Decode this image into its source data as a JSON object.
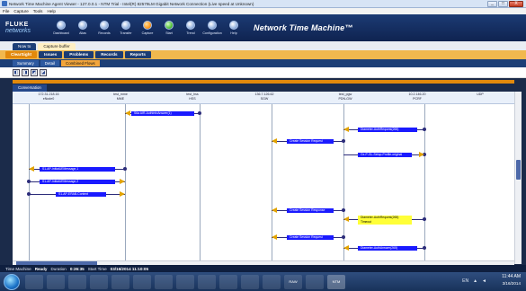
{
  "window": {
    "title": "Network Time Machine Agent Viewer - 127.0.0.1 - NTM Trial - Intel(R) 82579LM Gigabit Network Connection (Live speed at Unknown)",
    "buttons": [
      "_",
      "□",
      "X"
    ]
  },
  "menu": [
    "File",
    "Capture",
    "Tools",
    "Help"
  ],
  "toolbar": {
    "logo_line1": "FLUKE",
    "logo_line2": "networks",
    "items": [
      "Dashboard",
      "Alias",
      "Records",
      "Transfer",
      "Capture",
      "Start",
      "Trend",
      "Configuration",
      "Help"
    ],
    "product_title": "Network Time Machine™"
  },
  "tabs_level1": [
    {
      "label": "Now to",
      "active": false
    },
    {
      "label": "Capture buffer",
      "active": true
    }
  ],
  "tabs_level2": [
    {
      "label": "ClearSight",
      "active": true
    },
    {
      "label": "Issues",
      "active": false
    },
    {
      "label": "Problems",
      "active": false
    },
    {
      "label": "Records",
      "active": false
    },
    {
      "label": "Reports",
      "active": false
    }
  ],
  "tabs_level3": [
    {
      "label": "Summary",
      "active": false
    },
    {
      "label": "Detail",
      "active": false
    },
    {
      "label": "Combined Flows",
      "active": true
    }
  ],
  "view_buttons": [
    "◧",
    "◨",
    "◩",
    "◪"
  ],
  "conversation_tab": "Conversation",
  "columns": [
    {
      "ip": "172.31.218.16",
      "name": "eNode0"
    },
    {
      "ip": "",
      "name": "test_mme",
      "sub": "MME"
    },
    {
      "ip": "",
      "name": "test_hss",
      "sub": "HSS"
    },
    {
      "ip": "136.7.126.62",
      "name": "SGW"
    },
    {
      "ip": "",
      "name": "test_pgw",
      "sub": "PDN-GW"
    },
    {
      "ip": "10.2.146.20",
      "name": "PCRF"
    },
    {
      "ip": "",
      "name": "UDP"
    }
  ],
  "messages": [
    {
      "text": "S6a AIR-AuthInfoAnswer(1)",
      "highlight": false
    },
    {
      "text": "Create Session Request",
      "highlight": false
    },
    {
      "text": "Diameter-AuthRequest(265)",
      "highlight": false
    },
    {
      "text": "Gx-P-GL-Setup-Profile-original",
      "highlight": false
    },
    {
      "text": "S1-AP-InitialUEMessage,1",
      "highlight": false
    },
    {
      "text": "S1-AP-InitialUEMessage,2",
      "highlight": false
    },
    {
      "text": "S1-AP-ERAB-Context",
      "highlight": false
    },
    {
      "text": "Create Session Response",
      "highlight": false
    },
    {
      "text": "Diameter-AuthRequest(265) Timeout",
      "highlight": true
    },
    {
      "text": "Create Session Request",
      "highlight": false
    },
    {
      "text": "Diameter-AuthAnswer(265)",
      "highlight": false
    }
  ],
  "status": {
    "product_label": "Time Machine",
    "state": "Ready",
    "duration_label": "Duration",
    "duration": "0:26:35",
    "start_label": "Start Time",
    "start_time": "03/16/2014 11:10:05"
  },
  "taskbar": {
    "apps": [
      "IE",
      "Folder",
      "Media",
      "Office",
      "Excel",
      "Word",
      "Skype",
      "Chrome",
      "Media2",
      "Acrobat",
      "Outlook",
      "Paint",
      "RAW",
      "Tool",
      "NTM"
    ],
    "tray": "EN",
    "time": "11:44 AM",
    "date": "3/16/2014"
  },
  "colors": {
    "accent_orange": "#e2890c",
    "navy": "#1d3f77",
    "label_blue": "#1a1aff",
    "highlight_yellow": "#ffff38"
  }
}
